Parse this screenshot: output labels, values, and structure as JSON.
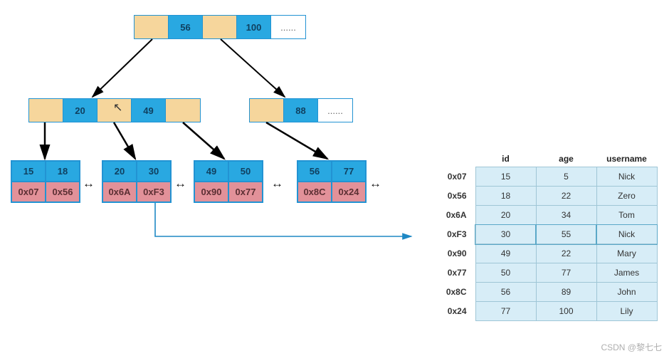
{
  "nodes": {
    "root": {
      "cells": [
        "",
        "56",
        "",
        "100",
        "......"
      ],
      "styles": [
        "tan",
        "blue",
        "tan",
        "blue",
        "white"
      ]
    },
    "inner1": {
      "cells": [
        "",
        "20",
        "",
        "49",
        ""
      ],
      "styles": [
        "tan",
        "blue",
        "tan",
        "blue",
        "tan"
      ]
    },
    "inner2": {
      "cells": [
        "",
        "88",
        "......"
      ],
      "styles": [
        "tan",
        "blue",
        "white"
      ]
    }
  },
  "leaves": [
    {
      "keys": [
        "15",
        "18"
      ],
      "ptrs": [
        "0x07",
        "0x56"
      ]
    },
    {
      "keys": [
        "20",
        "30"
      ],
      "ptrs": [
        "0x6A",
        "0xF3"
      ]
    },
    {
      "keys": [
        "49",
        "50"
      ],
      "ptrs": [
        "0x90",
        "0x77"
      ]
    },
    {
      "keys": [
        "56",
        "77"
      ],
      "ptrs": [
        "0x8C",
        "0x24"
      ]
    }
  ],
  "table": {
    "headers": [
      "id",
      "age",
      "username"
    ],
    "rows": [
      {
        "addr": "0x07",
        "id": "15",
        "age": "5",
        "username": "Nick"
      },
      {
        "addr": "0x56",
        "id": "18",
        "age": "22",
        "username": "Zero"
      },
      {
        "addr": "0x6A",
        "id": "20",
        "age": "34",
        "username": "Tom"
      },
      {
        "addr": "0xF3",
        "id": "30",
        "age": "55",
        "username": "Nick"
      },
      {
        "addr": "0x90",
        "id": "49",
        "age": "22",
        "username": "Mary"
      },
      {
        "addr": "0x77",
        "id": "50",
        "age": "77",
        "username": "James"
      },
      {
        "addr": "0x8C",
        "id": "56",
        "age": "89",
        "username": "John"
      },
      {
        "addr": "0x24",
        "id": "77",
        "age": "100",
        "username": "Lily"
      }
    ],
    "highlight_addr": "0xF3"
  },
  "watermark": "CSDN @黎七七"
}
